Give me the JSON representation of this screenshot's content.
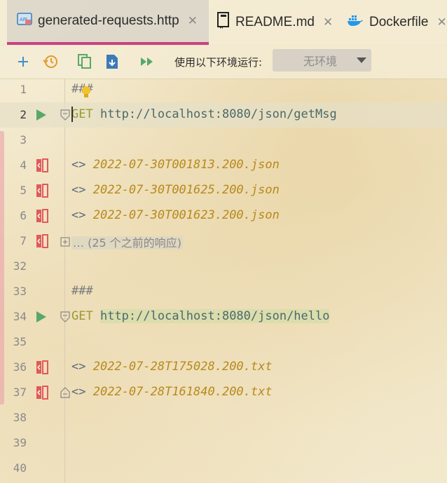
{
  "tabs": [
    {
      "label": "generated-requests.http",
      "icon": "api-file-icon",
      "active": true
    },
    {
      "label": "README.md",
      "icon": "book-icon",
      "active": false
    },
    {
      "label": "Dockerfile",
      "icon": "docker-icon",
      "active": false
    }
  ],
  "toolbar": {
    "env_label": "使用以下环境运行:",
    "env_value": "无环境"
  },
  "editor": {
    "lines": [
      {
        "num": "1",
        "text": "###"
      },
      {
        "num": "2",
        "method": "GET",
        "url": "http://localhost:8080/json/getMsg"
      },
      {
        "num": "3"
      },
      {
        "num": "4",
        "arrow": "<>",
        "file": "2022-07-30T001813.200.json"
      },
      {
        "num": "5",
        "arrow": "<>",
        "file": "2022-07-30T001625.200.json"
      },
      {
        "num": "6",
        "arrow": "<>",
        "file": "2022-07-30T001623.200.json"
      },
      {
        "num": "7",
        "collapsed": "… (25 个之前的响应)"
      },
      {
        "num": "32"
      },
      {
        "num": "33",
        "text": "###"
      },
      {
        "num": "34",
        "method": "GET",
        "url": "http://localhost:8080/json/hello"
      },
      {
        "num": "35"
      },
      {
        "num": "36",
        "arrow": "<>",
        "file": "2022-07-28T175028.200.txt"
      },
      {
        "num": "37",
        "arrow": "<>",
        "file": "2022-07-28T161840.200.txt"
      },
      {
        "num": "38"
      },
      {
        "num": "39"
      },
      {
        "num": "40"
      }
    ]
  },
  "colors": {
    "accent": "#c8427f",
    "run": "#59a869",
    "file": "#b8891c"
  }
}
